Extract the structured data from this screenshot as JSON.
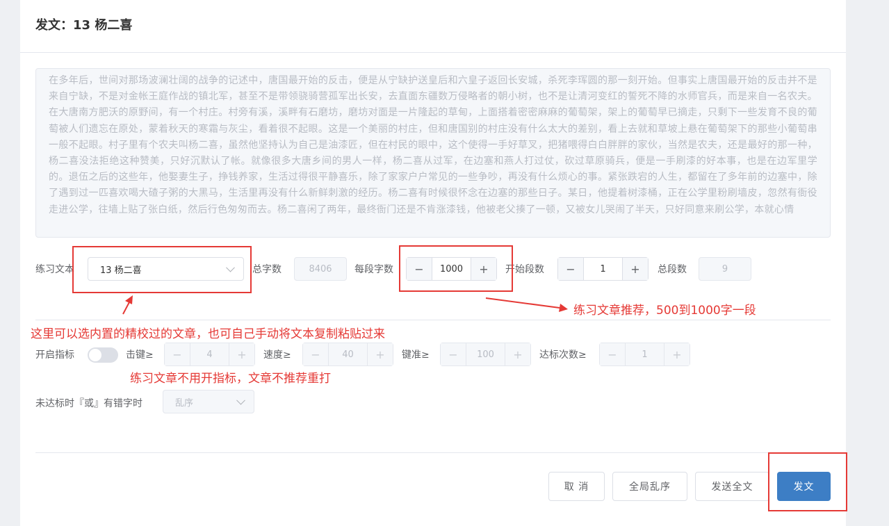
{
  "dialog": {
    "title": "发文：13 杨二喜",
    "article_text": "在多年后，世间对那场波澜壮阔的战争的记述中，唐国最开始的反击，便是从宁缺护送皇后和六皇子返回长安城，杀死李珲圆的那一刻开始。但事实上唐国最开始的反击并不是来自宁缺，不是对金帐王庭作战的镇北军，甚至不是带领骁骑营孤军出长安，去直面东疆数万侵略者的朝小树，也不是让清河变红的誓死不降的水师官兵，而是来自一名农夫。在大唐南方肥沃的原野间，有一个村庄。村旁有溪，溪畔有石磨坊，磨坊对面是一片隆起的草甸，上面搭着密密麻麻的葡萄架，架上的葡萄早已摘走，只剩下一些发育不良的葡萄被人们遗忘在原处，蒙着秋天的寒霜与灰尘，看着很不起眼。这是一个美丽的村庄，但和唐国别的村庄没有什么太大的差别，看上去就和草坡上悬在葡萄架下的那些小葡萄串一般不起眼。村子里有个农夫叫杨二喜，虽然他坚持认为自己是油漆匠，但在村民的眼中，这个使得一手好草叉，把猪喂得白白胖胖的家伙，当然是农夫，还是最好的那一种，杨二喜没法拒绝这种赞美，只好沉默认了帐。就像很多大唐乡间的男人一样，杨二喜从过军，在边塞和燕人打过仗，砍过草原骑兵，便是一手刷漆的好本事，也是在边军里学的。退伍之后的这些年，他娶妻生子，挣钱养家，生活过得很平静喜乐，除了家家户户常见的一些争吵，再没有什么烦心的事。紧张跌宕的人生，都留在了多年前的边塞中，除了遇到过一匹喜欢喝大碴子粥的大黑马，生活里再没有什么新鲜刺激的经历。杨二喜有时候很怀念在边塞的那些日子。某日，他提着树漆桶，正在公学里粉刷墙皮，忽然有衙役走进公学，往墙上贴了张白纸，然后行色匆匆而去。杨二喜闲了两年，最终衙门还是不肯涨漆钱，他被老父揍了一顿，又被女儿哭闹了半天，只好同意来刷公学，本就心情"
  },
  "row1": {
    "text_label": "练习文本",
    "text_select": "13 杨二喜",
    "total_chars_label": "总字数",
    "total_chars": "8406",
    "per_segment_label": "每段字数",
    "per_segment": "1000",
    "start_segment_label": "开始段数",
    "start_segment": "1",
    "total_segments_label": "总段数",
    "total_segments": "9"
  },
  "row2": {
    "enable_label": "开启指标",
    "keystroke_label": "击键≥",
    "keystroke": "4",
    "speed_label": "速度≥",
    "speed": "40",
    "accuracy_label": "键准≥",
    "accuracy": "100",
    "times_label": "达标次数≥",
    "times": "1"
  },
  "row3": {
    "fail_label": "未达标时『或』有错字时",
    "fail_select": "乱序"
  },
  "stepper_symbols": {
    "minus": "−",
    "plus": "+"
  },
  "footer": {
    "cancel": "取 消",
    "shuffle_all": "全局乱序",
    "send_all": "发送全文",
    "send": "发文"
  },
  "annotations": {
    "note1": "这里可以选内置的精校过的文章，也可自己手动将文本复制粘贴过来",
    "note2": "练习文章推荐，500到1000字一段",
    "note3": "练习文章不用开指标，文章不推荐重打"
  },
  "colors": {
    "primary": "#3d7ec5",
    "annotation": "#e53935"
  }
}
